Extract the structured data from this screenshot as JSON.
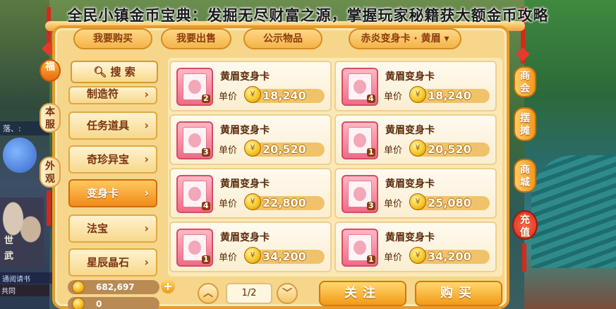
{
  "headline": "全民小镇金币宝典：发掘无尽财富之源，掌握玩家秘籍获大额金币攻略",
  "tabs": [
    {
      "label": "我要购买"
    },
    {
      "label": "我要出售"
    },
    {
      "label": "公示物品"
    },
    {
      "label": "赤炎变身卡 · 黄眉"
    }
  ],
  "left_tabs": [
    {
      "label": "福"
    },
    {
      "label": "本服"
    },
    {
      "label": "外观"
    }
  ],
  "right_tabs": [
    {
      "label": "商会"
    },
    {
      "label": "摆摊"
    },
    {
      "label": "商城"
    },
    {
      "label": "充值"
    }
  ],
  "search_label": "搜 索",
  "categories": [
    {
      "label": "制造符"
    },
    {
      "label": "任务道具"
    },
    {
      "label": "奇珍异宝"
    },
    {
      "label": "变身卡"
    },
    {
      "label": "法宝"
    },
    {
      "label": "星辰晶石"
    }
  ],
  "active_category": "变身卡",
  "currency": [
    {
      "value": "682,697"
    },
    {
      "value": "0"
    }
  ],
  "price_label": "单价",
  "items": [
    {
      "name": "黄眉变身卡",
      "qty": "2",
      "price": "18,240"
    },
    {
      "name": "黄眉变身卡",
      "qty": "4",
      "price": "18,240"
    },
    {
      "name": "黄眉变身卡",
      "qty": "3",
      "price": "20,520"
    },
    {
      "name": "黄眉变身卡",
      "qty": "1",
      "price": "20,520"
    },
    {
      "name": "黄眉变身卡",
      "qty": "4",
      "price": "22,800"
    },
    {
      "name": "黄眉变身卡",
      "qty": "3",
      "price": "25,080"
    },
    {
      "name": "黄眉变身卡",
      "qty": "1",
      "price": "34,200"
    },
    {
      "name": "黄眉变身卡",
      "qty": "1",
      "price": "34,200"
    }
  ],
  "pagination": {
    "text": "1/2"
  },
  "buttons": {
    "follow": "关注",
    "buy": "购买"
  },
  "background_text": {
    "status": "落、:",
    "side1": "世",
    "side2": "武",
    "chat": "通阅请书",
    "bottom": "共同"
  },
  "colors": {
    "panel": "#f6d68a",
    "border": "#e79b2a",
    "active": "#f08b1a",
    "text": "#7a3310"
  }
}
